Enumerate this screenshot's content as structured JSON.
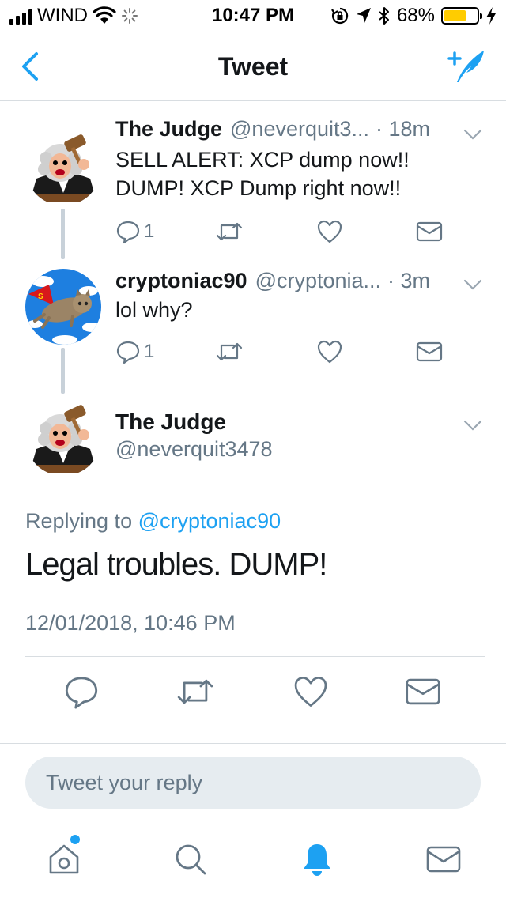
{
  "status_bar": {
    "carrier": "WIND",
    "time": "10:47 PM",
    "battery_percent": "68%",
    "battery_level": 0.68,
    "battery_color": "#ffcc00",
    "icons": [
      "signal-icon",
      "wifi-icon",
      "activity-spinner-icon",
      "rotation-lock-icon",
      "location-icon",
      "bluetooth-icon",
      "battery-icon",
      "charging-bolt-icon"
    ]
  },
  "navbar": {
    "title": "Tweet",
    "back_icon": "back-chevron-icon",
    "compose_icon": "compose-tweet-icon"
  },
  "thread": [
    {
      "name": "The Judge",
      "handle": "@neverquit3...",
      "time": "· 18m",
      "text_line1": "SELL ALERT: XCP dump now!!",
      "text_line2": "DUMP! XCP Dump right now!!",
      "reply_count": "1",
      "avatar": "judge-avatar"
    },
    {
      "name": "cryptoniac90",
      "handle": "@cryptonia...",
      "time": "· 3m",
      "text_line1": "lol why?",
      "reply_count": "1",
      "avatar": "supercat-avatar"
    }
  ],
  "focused_tweet": {
    "name": "The Judge",
    "handle": "@neverquit3478",
    "replying_prefix": "Replying to",
    "replying_to": "@cryptoniac90",
    "text": "Legal troubles. DUMP!",
    "date": "12/01/2018, 10:46 PM"
  },
  "reply_box": {
    "placeholder": "Tweet your reply"
  },
  "tabbar": {
    "tabs": [
      "home-icon",
      "search-icon",
      "notifications-icon",
      "messages-icon"
    ],
    "active": "notifications-icon",
    "home_has_new": true
  },
  "colors": {
    "accent": "#1da1f2",
    "text": "#14171a",
    "secondary": "#657786",
    "divider": "#d8dde1"
  }
}
